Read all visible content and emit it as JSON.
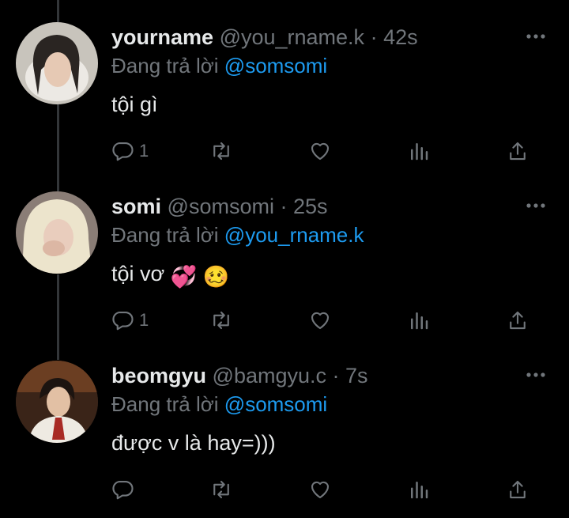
{
  "reply_prefix": "Đang trả lời",
  "tweets": [
    {
      "name": "yourname",
      "handle": "@you_rname.k",
      "separator": "·",
      "time": "42s",
      "reply_to": "@somsomi",
      "text": "tội gì",
      "reply_count": "1",
      "emojis": []
    },
    {
      "name": "somi",
      "handle": "@somsomi",
      "separator": "·",
      "time": "25s",
      "reply_to": "@you_rname.k",
      "text": "tội vơ",
      "reply_count": "1",
      "emojis": [
        "💞",
        "🥴"
      ]
    },
    {
      "name": "beomgyu",
      "handle": "@bamgyu.c",
      "separator": "·",
      "time": "7s",
      "reply_to": "@somsomi",
      "text": "được v là hay=)))",
      "reply_count": "",
      "emojis": []
    }
  ],
  "icons": [
    "more-icon",
    "reply-icon",
    "retweet-icon",
    "like-icon",
    "analytics-icon",
    "share-icon"
  ],
  "colors": {
    "background": "#000000",
    "text": "#e7e9ea",
    "muted": "#71767b",
    "link": "#1d9bf0"
  }
}
